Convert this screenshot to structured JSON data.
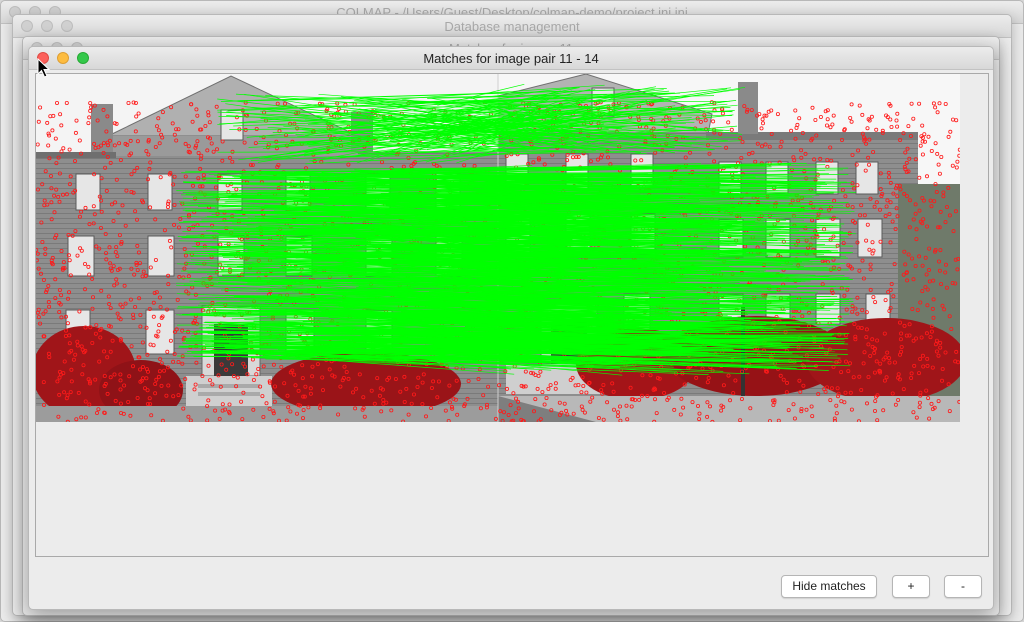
{
  "windows": {
    "main_title": "COLMAP - /Users/Guest/Desktop/colmap-demo/project.ini.ini",
    "db_title": "Database management",
    "image_title": "Matches for image 11",
    "pair_title": "Matches for image pair 11 - 14"
  },
  "buttons": {
    "hide_matches": "Hide matches",
    "zoom_in": "+",
    "zoom_out": "-"
  },
  "colors": {
    "match_line": "#00ff00",
    "keypoint": "#ff1a1a"
  }
}
